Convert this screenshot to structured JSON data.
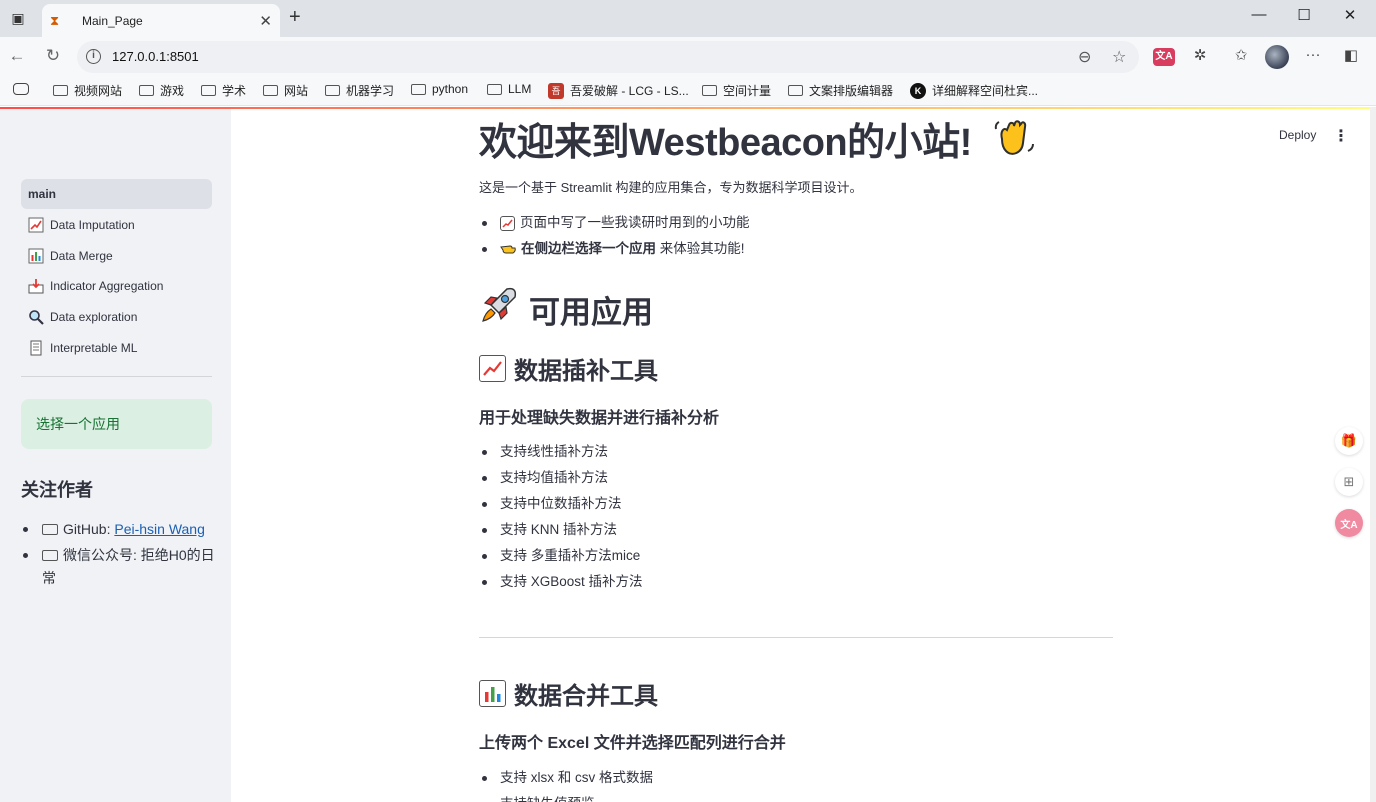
{
  "browser": {
    "tab_title": "Main_Page",
    "url": "127.0.0.1:8501",
    "bookmarks": [
      {
        "label": "视频网站"
      },
      {
        "label": "游戏"
      },
      {
        "label": "学术"
      },
      {
        "label": "网站"
      },
      {
        "label": "机器学习"
      },
      {
        "label": "python"
      },
      {
        "label": "LLM"
      },
      {
        "label": "吾爱破解 - LCG - LS..."
      },
      {
        "label": "空间计量"
      },
      {
        "label": "文案排版编辑器"
      },
      {
        "label": "详细解释空间杜宾..."
      }
    ]
  },
  "sidebar": {
    "nav": [
      {
        "label": "main",
        "icon": "",
        "active": true
      },
      {
        "label": "Data Imputation",
        "icon": "chart-increasing-icon"
      },
      {
        "label": "Data Merge",
        "icon": "bar-chart-icon"
      },
      {
        "label": "Indicator Aggregation",
        "icon": "inbox-tray-icon"
      },
      {
        "label": "Data exploration",
        "icon": "magnifier-icon"
      },
      {
        "label": "Interpretable ML",
        "icon": "document-icon"
      }
    ],
    "select_hint": "选择一个应用",
    "follow_title": "关注作者",
    "github_prefix": "GitHub: ",
    "github_link": "Pei-hsin Wang",
    "wechat": "微信公众号: 拒绝H0的日常"
  },
  "header": {
    "deploy_label": "Deploy",
    "menu_glyph": "⋮"
  },
  "main": {
    "title": "欢迎来到Westbeacon的小站!",
    "title_emoji": "👋",
    "intro": "这是一个基于 Streamlit 构建的应用集合，专为数据科学项目设计。",
    "intro_bullets": {
      "b1_text": "页面中写了一些我读研时用到的小功能",
      "b2_bold": "在侧边栏选择一个应用",
      "b2_rest": " 来体验其功能!"
    },
    "section_title": "可用应用",
    "apps": [
      {
        "title": "数据插补工具",
        "subtitle": "用于处理缺失数据并进行插补分析",
        "features": [
          "支持线性插补方法",
          "支持均值插补方法",
          "支持中位数插补方法",
          "支持 KNN 插补方法",
          "支持 多重插补方法mice",
          "支持 XGBoost 插补方法"
        ]
      },
      {
        "title": "数据合并工具",
        "subtitle": "上传两个 Excel 文件并选择匹配列进行合并",
        "features": [
          "支持 xlsx 和 csv 格式数据",
          "支持缺失值预览"
        ]
      }
    ]
  },
  "colors": {
    "sidebar_bg": "#f0f2f6",
    "success_bg": "#dbefe2",
    "success_text": "#177233",
    "link": "#1a5fb4",
    "text": "#31333f"
  }
}
